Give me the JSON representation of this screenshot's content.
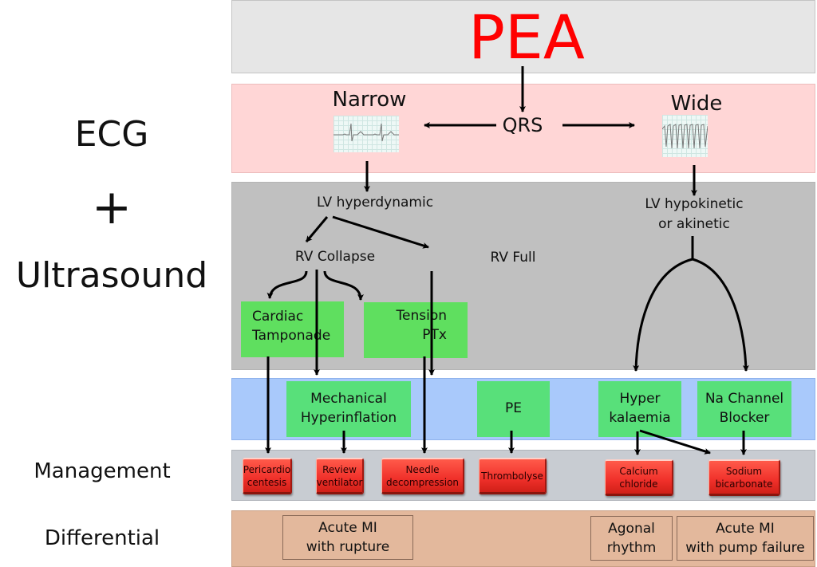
{
  "side_labels": {
    "ecg": "ECG",
    "plus": "+",
    "ultrasound": "Ultrasound",
    "management": "Management",
    "differential": "Differential"
  },
  "title": "PEA",
  "ecg_row": {
    "narrow": "Narrow",
    "wide": "Wide",
    "qrs": "QRS"
  },
  "ultrasound_row": {
    "lv_hyperdynamic": "LV hyperdynamic",
    "lv_hypokinetic_line1": "LV hypokinetic",
    "lv_hypokinetic_line2": "or akinetic",
    "rv_collapse": "RV Collapse",
    "rv_full": "RV Full",
    "cardiac_tamponade_line1": "Cardiac",
    "cardiac_tamponade_line2": "Tamponade",
    "tension_ptx_line1": "Tension",
    "tension_ptx_line2": "PTx"
  },
  "diagnosis_row": {
    "mechanical_line1": "Mechanical",
    "mechanical_line2": "Hyperinflation",
    "pe": "PE",
    "hyperk_line1": "Hyper",
    "hyperk_line2": "kalaemia",
    "na_line1": "Na Channel",
    "na_line2": "Blocker"
  },
  "management_row": [
    {
      "line1": "Pericardio",
      "line2": "centesis"
    },
    {
      "line1": "Review",
      "line2": "ventilator"
    },
    {
      "line1": "Needle",
      "line2": "decompression"
    },
    {
      "line1": "Thrombolyse",
      "line2": ""
    },
    {
      "line1": "Calcium",
      "line2": "chloride"
    },
    {
      "line1": "Sodium",
      "line2": "bicarbonate"
    }
  ],
  "differential_row": [
    {
      "line1": "Acute MI",
      "line2": "with rupture"
    },
    {
      "line1": "Agonal",
      "line2": "rhythm"
    },
    {
      "line1": "Acute MI",
      "line2": "with pump failure"
    }
  ],
  "colors": {
    "title": "#ff0000",
    "ecg_band": "#ffd6d6",
    "ultrasound_band": "#c0c0c0",
    "diagnosis_band": "#a9c9fb",
    "management_band": "#c8ccd2",
    "differential_band": "#e3b89c",
    "green_box": "#5fdf5f",
    "red_button": "#f0302a"
  }
}
